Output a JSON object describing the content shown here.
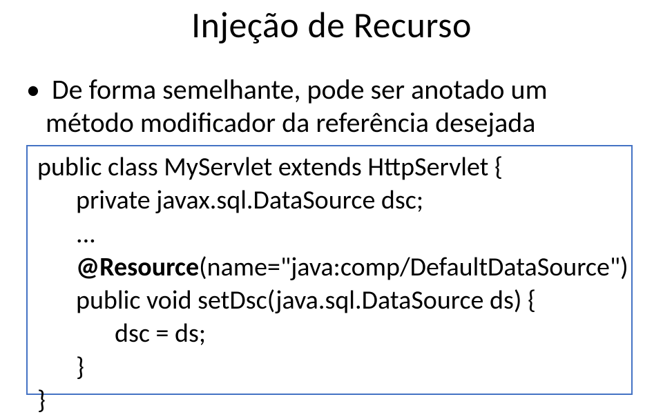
{
  "title": "Injeção de Recurso",
  "bullet_line1": "De forma semelhante, pode ser anotado um",
  "bullet_line2": "método modificador da referência desejada",
  "code": {
    "l1": "public class MyServlet extends HttpServlet {",
    "l2": "private javax.sql.DataSource dsc;",
    "l3": "...",
    "l4": "@Resource",
    "l4b": "(name=\"java:comp/DefaultDataSource\")",
    "l5": "public void setDsc(java.sql.DataSource ds) {",
    "l6": "dsc = ds;",
    "l7": "}",
    "l8": "}"
  }
}
